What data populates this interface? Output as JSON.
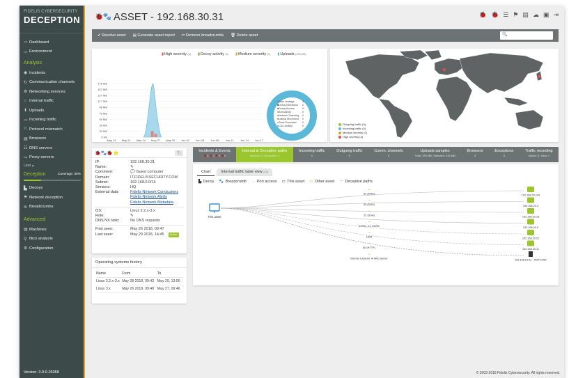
{
  "brand": {
    "line1": "FIDELIS CYBERSECURITY",
    "line2": "DECEPTION"
  },
  "sidebar": {
    "top_items": [
      {
        "icon": "dashboard-icon",
        "glyph": "▭",
        "label": "Dashboard"
      },
      {
        "icon": "environment-icon",
        "glyph": "▭",
        "label": "Environment"
      }
    ],
    "analysis_title": "Analysis",
    "analysis_items": [
      {
        "icon": "incidents-icon",
        "glyph": "◉",
        "label": "Incidents"
      },
      {
        "icon": "channels-icon",
        "glyph": "↻",
        "label": "Communication channels"
      },
      {
        "icon": "services-icon",
        "glyph": "⚙",
        "label": "Networking services"
      },
      {
        "icon": "traffic-icon",
        "glyph": "⌂",
        "label": "Internal traffic"
      },
      {
        "icon": "uploads-icon",
        "glyph": "⬆",
        "label": "Uploads"
      },
      {
        "icon": "incoming-icon",
        "glyph": "▭",
        "label": "Incoming traffic"
      },
      {
        "icon": "protocol-icon",
        "glyph": "⤫",
        "label": "Protocol mismatch"
      },
      {
        "icon": "browsers-icon",
        "glyph": "▤",
        "label": "Browsers"
      },
      {
        "icon": "dns-icon",
        "glyph": "☷",
        "label": "DNS servers"
      },
      {
        "icon": "proxy-icon",
        "glyph": "↪",
        "label": "Proxy servers"
      }
    ],
    "less_label": "Less ▴",
    "deception_title": "Deception",
    "coverage_label": "Coverage: 30%",
    "coverage_fraction": 0.3,
    "deception_items": [
      {
        "icon": "decoys-icon",
        "glyph": "▙",
        "label": "Decoys"
      },
      {
        "icon": "network-deception-icon",
        "glyph": "⚑",
        "label": "Network deception"
      },
      {
        "icon": "breadcrumbs-icon",
        "glyph": "≋",
        "label": "Breadcrumbs"
      }
    ],
    "advanced_title": "Advanced",
    "advanced_items": [
      {
        "icon": "machines-icon",
        "glyph": "▤",
        "label": "Machines"
      },
      {
        "icon": "nics-icon",
        "glyph": "⚲",
        "label": "Nics analysis"
      },
      {
        "icon": "configuration-icon",
        "glyph": "⚙",
        "label": "Configuration"
      }
    ],
    "version": "Version: 3.0.0-26068"
  },
  "header": {
    "icons": "🐞🐾",
    "title": "ASSET - 192.168.30.31",
    "right_icons": [
      "🐞",
      "🐞",
      "☰",
      "⚑",
      "▤",
      "☁",
      "▣",
      "⇥"
    ]
  },
  "toolbar": {
    "resolve": "✔ Resolve asset",
    "report": "▤ Generate asset report",
    "remove_breadcrumbs": "⚯ Remove breadcrumbs",
    "delete": "🗑 Delete asset",
    "search_placeholder": "🔍"
  },
  "chart_data": {
    "type": "area",
    "legend": [
      {
        "name": "High severity",
        "count": "(3)",
        "color": "#d9534f"
      },
      {
        "name": "Decoy activity",
        "count": "(0)",
        "color": "#7aa23a"
      },
      {
        "name": "Medium severity",
        "count": "(0)",
        "color": "#e0a23a"
      },
      {
        "name": "Uploads",
        "count": "(330 MB)",
        "color": "#5bb8d9"
      }
    ],
    "y_ticks": [
      "178 MB",
      "157 MB",
      "137 MB",
      "117 MB",
      "98 MB",
      "78 MB",
      "59 MB",
      "39 MB",
      "20 MB",
      "0 KB"
    ],
    "ylim": [
      0,
      178
    ],
    "x_ticks": [
      "May 19",
      "May 21",
      "May 24",
      "May 27",
      "May 30",
      "Jun 02",
      "Jun 05",
      "Jun 08",
      "Jun 11",
      "Jun 14",
      "Jun 17"
    ],
    "upload_peak_mb": 178,
    "bars_high": [
      20,
      11
    ],
    "donut": {
      "rows": [
        {
          "name": "Data Leakage",
          "value": "3",
          "color": "#d9534f"
        },
        {
          "name": "Decoy Interaction",
          "value": "0",
          "color": "#333333"
        },
        {
          "name": "Decoy Access",
          "value": "0",
          "color": "#555555"
        },
        {
          "name": "Bot Activity",
          "value": "0",
          "color": "#e0a23a"
        },
        {
          "name": "Network Scanning",
          "value": "0",
          "color": "#8c8c8c"
        },
        {
          "name": "Lateral Movement",
          "value": "0",
          "color": "#7aa23a"
        },
        {
          "name": "Tools Download",
          "value": "0",
          "color": "#999999"
        },
        {
          "name": "C&C Activity",
          "value": "0",
          "color": "#5bb8d9"
        }
      ]
    }
  },
  "map": {
    "legend": [
      {
        "name": "Outgoing traffic (0)",
        "color": "#9cc62e"
      },
      {
        "name": "Incoming traffic (0)",
        "color": "#5bb8d9"
      },
      {
        "name": "Medium severity (0)",
        "color": "#e0a23a"
      },
      {
        "name": "High severity (4)",
        "color": "#d9534f"
      }
    ]
  },
  "details": {
    "header_icons": "🐞🐾🐞⭐",
    "tag_icon": "🏷",
    "rows_a": [
      {
        "k": "IP:",
        "v": "192.168.30.31"
      },
      {
        "k": "Name:",
        "v": "✎"
      },
      {
        "k": "Comment:",
        "v": "💬 Guest computer"
      },
      {
        "k": "Domain:",
        "v": "IT.FIDELISSECURITY.COM"
      },
      {
        "k": "Subnet:",
        "v": "192.168.0.0/16"
      },
      {
        "k": "Sensors:",
        "v": "HQ"
      }
    ],
    "external_label": "External data:",
    "external_links": [
      "Fidelis Network Conclusions",
      "Fidelis Network Alerts",
      "Fidelis Network Metadata"
    ],
    "rows_b": [
      {
        "k": "OS:",
        "v": "Linux 2.2.x-3.x"
      },
      {
        "k": "Role:",
        "v": "✎"
      },
      {
        "k": "DNS NX ratio:",
        "v": "No DNS requests"
      }
    ],
    "first_seen_label": "First seen:",
    "first_seen": "May 26 2018, 09:47",
    "last_seen_label": "Last seen:",
    "last_seen": "May 29 2018, 14:45",
    "active_badge": "Active"
  },
  "os_history": {
    "title": "Operating systems history",
    "headers": [
      "Name",
      "From",
      "To"
    ],
    "rows": [
      [
        "Linux 2.2.x-3.x",
        "May 28 2018, 09:43",
        "May 29, 13:56"
      ],
      [
        "Linux 3.x",
        "May 26 2018, 09:48",
        "May 27, 09:46"
      ]
    ]
  },
  "tabs": [
    {
      "label": "Incidents & Events",
      "sub": "🐞3 🐞0 🐞0 🐞0",
      "active": false
    },
    {
      "label": "Internal & Deceptive paths",
      "sub": "Internal: 5, Deceptive: 1",
      "active": true
    },
    {
      "label": "Incoming traffic",
      "sub": "0",
      "active": false
    },
    {
      "label": "Outgoing traffic",
      "sub": "0",
      "active": false
    },
    {
      "label": "Comm. channels",
      "sub": "0",
      "active": false
    },
    {
      "label": "Uploads samples",
      "sub": "Total: 330 MB, Samples: 315 MB",
      "active": false
    },
    {
      "label": "Browsers",
      "sub": "3",
      "active": false
    },
    {
      "label": "Exceptions",
      "sub": "0",
      "active": false
    },
    {
      "label": "Traffic recording",
      "sub": "Active: 0, Total: 1",
      "active": false
    }
  ],
  "graph": {
    "subtab_chart": "Chart",
    "subtab_table": "Internal traffic table view",
    "subtab_table_count": "(10)",
    "legend": [
      {
        "icon": "decoy-icon",
        "glyph": "▙",
        "label": "Decoy",
        "color": "#333"
      },
      {
        "icon": "breadcrumb-icon",
        "glyph": "🐾",
        "label": "Breadcrumb",
        "color": "#c0392b"
      },
      {
        "icon": "port-access-icon",
        "glyph": "→",
        "label": "Port access",
        "color": "#7aa23a"
      },
      {
        "icon": "this-asset-icon",
        "glyph": "▭",
        "label": "This asset",
        "color": "#333"
      },
      {
        "icon": "other-asset-icon",
        "glyph": "▭",
        "label": "Other asset",
        "color": "#9cc62e"
      },
      {
        "icon": "deceptive-paths-icon",
        "glyph": "⋯",
        "label": "Deceptive paths",
        "color": "#333"
      }
    ],
    "source_label": "This asset",
    "edges": [
      {
        "port": "53 (DNS)",
        "target": "192.168.20.100"
      },
      {
        "port": "53 (DNS)",
        "target": "192.168.20.4"
      },
      {
        "port": "22 (SSH)",
        "target": "192.168.20.18"
      },
      {
        "port": "43902, 21, 25209",
        "target": "192.168.20.8"
      },
      {
        "port": "1605",
        "target": "192.168.20.22"
      },
      {
        "port": "80 (HTTP)",
        "target": "192.168.20.11"
      }
    ],
    "deceptive_edge": {
      "label": "Internet Explorer ➔ Web Server",
      "target": "192.168.14.51 - SWTCV8K"
    }
  },
  "copyright": "© 2003-2018 Fidelis Cybersecurity. All rights reserved."
}
